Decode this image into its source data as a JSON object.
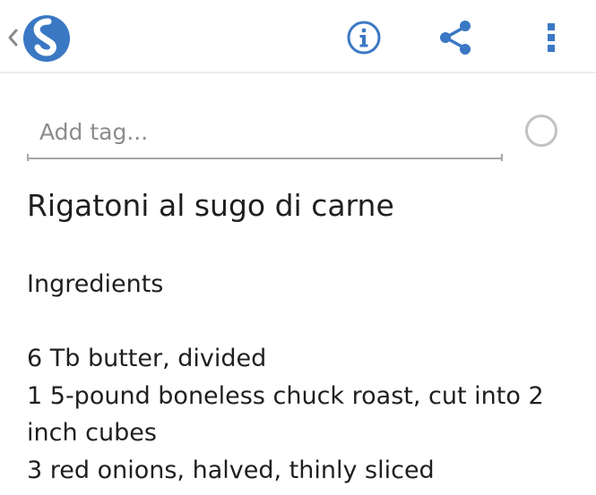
{
  "toolbar": {
    "back_icon": "chevron-left-icon",
    "logo_icon": "simplenote-logo-icon",
    "info_icon": "info-icon",
    "share_icon": "share-icon",
    "menu_icon": "more-vertical-icon",
    "accent_color": "#3b78c4"
  },
  "tags": {
    "placeholder": "Add tag...",
    "value": ""
  },
  "pin": {
    "icon": "circle-toggle-icon",
    "checked": false
  },
  "note": {
    "title": "Rigatoni al sugo di carne",
    "section_heading": "Ingredients",
    "ingredients": [
      "6 Tb butter, divided",
      "1 5-pound boneless chuck roast, cut into 2 inch cubes",
      "3 red onions, halved, thinly sliced"
    ]
  }
}
